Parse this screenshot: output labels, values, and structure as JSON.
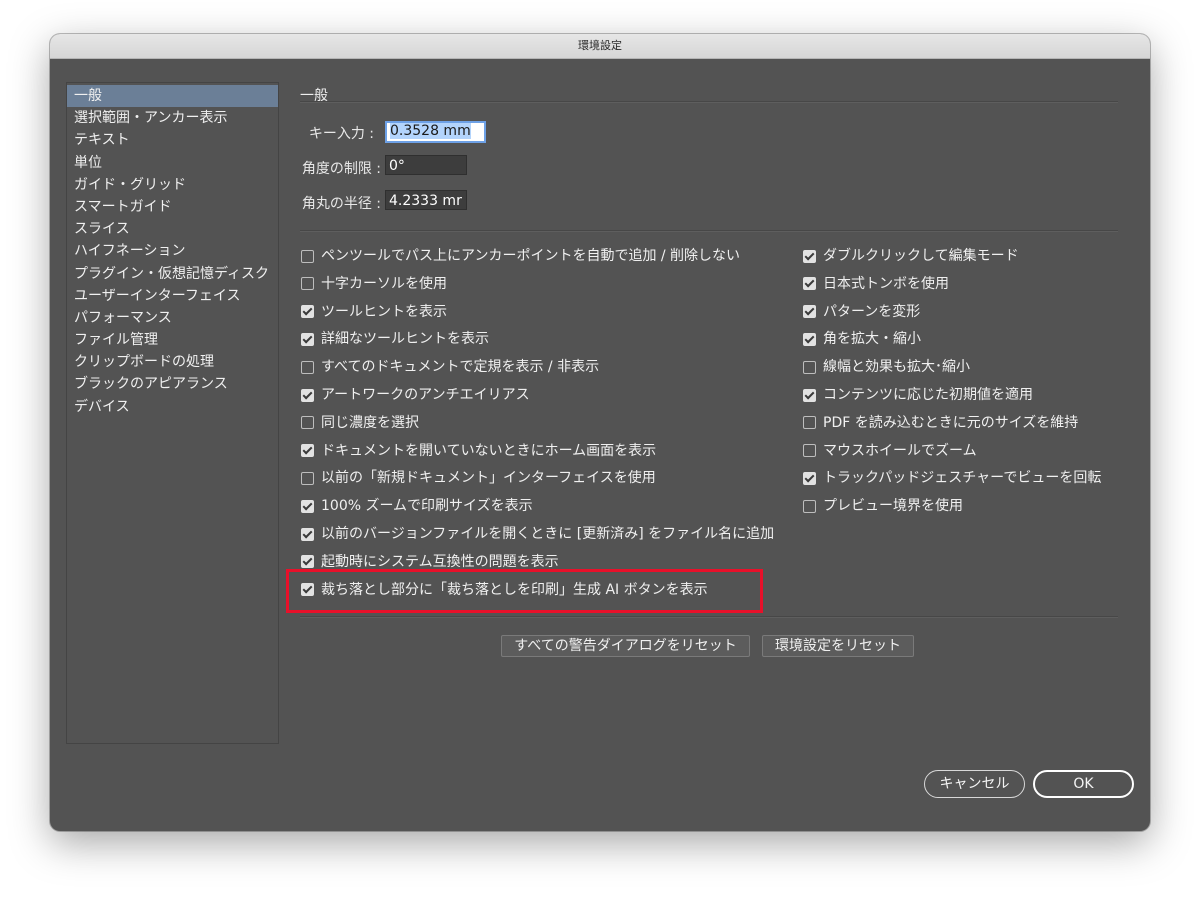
{
  "window": {
    "title": "環境設定"
  },
  "sidebar": {
    "items": [
      {
        "label": "一般",
        "selected": true
      },
      {
        "label": "選択範囲・アンカー表示"
      },
      {
        "label": "テキスト"
      },
      {
        "label": "単位"
      },
      {
        "label": "ガイド・グリッド"
      },
      {
        "label": "スマートガイド"
      },
      {
        "label": "スライス"
      },
      {
        "label": "ハイフネーション"
      },
      {
        "label": "プラグイン・仮想記憶ディスク"
      },
      {
        "label": "ユーザーインターフェイス"
      },
      {
        "label": "パフォーマンス"
      },
      {
        "label": "ファイル管理"
      },
      {
        "label": "クリップボードの処理"
      },
      {
        "label": "ブラックのアピアランス"
      },
      {
        "label": "デバイス"
      }
    ]
  },
  "main": {
    "section_title": "一般",
    "fields": {
      "key_input": {
        "label": "キー入力 :",
        "value": "0.3528 mm"
      },
      "constrain_angle": {
        "label": "角度の制限 :",
        "value": "0°"
      },
      "corner_radius": {
        "label": "角丸の半径 :",
        "value": "4.2333 mr"
      }
    },
    "left_options": [
      {
        "label": "ペンツールでパス上にアンカーポイントを自動で追加 / 削除しない",
        "checked": false
      },
      {
        "label": "十字カーソルを使用",
        "checked": false
      },
      {
        "label": "ツールヒントを表示",
        "checked": true
      },
      {
        "label": "詳細なツールヒントを表示",
        "checked": true
      },
      {
        "label": "すべてのドキュメントで定規を表示 / 非表示",
        "checked": false
      },
      {
        "label": "アートワークのアンチエイリアス",
        "checked": true
      },
      {
        "label": "同じ濃度を選択",
        "checked": false
      },
      {
        "label": "ドキュメントを開いていないときにホーム画面を表示",
        "checked": true
      },
      {
        "label": "以前の「新規ドキュメント」インターフェイスを使用",
        "checked": false
      },
      {
        "label": "100% ズームで印刷サイズを表示",
        "checked": true
      },
      {
        "label": "以前のバージョンファイルを開くときに [更新済み] をファイル名に追加",
        "checked": true
      },
      {
        "label": "起動時にシステム互換性の問題を表示",
        "checked": true
      },
      {
        "label": "裁ち落とし部分に「裁ち落としを印刷」生成 AI ボタンを表示",
        "checked": true
      }
    ],
    "right_options": [
      {
        "label": "ダブルクリックして編集モード",
        "checked": true
      },
      {
        "label": "日本式トンボを使用",
        "checked": true
      },
      {
        "label": "パターンを変形",
        "checked": true
      },
      {
        "label": "角を拡大・縮小",
        "checked": true
      },
      {
        "label": "線幅と効果も拡大･縮小",
        "checked": false
      },
      {
        "label": "コンテンツに応じた初期値を適用",
        "checked": true
      },
      {
        "label": "PDF を読み込むときに元のサイズを維持",
        "checked": false
      },
      {
        "label": "マウスホイールでズーム",
        "checked": false
      },
      {
        "label": "トラックパッドジェスチャーでビューを回転",
        "checked": true
      },
      {
        "label": "プレビュー境界を使用",
        "checked": false
      }
    ],
    "reset_warnings_label": "すべての警告ダイアログをリセット",
    "reset_prefs_label": "環境設定をリセット"
  },
  "footer": {
    "cancel_label": "キャンセル",
    "ok_label": "OK"
  },
  "colors": {
    "panel": "#535353",
    "selection": "#6b7f97",
    "highlight": "#e8102a",
    "focus": "#6ea1e6"
  }
}
